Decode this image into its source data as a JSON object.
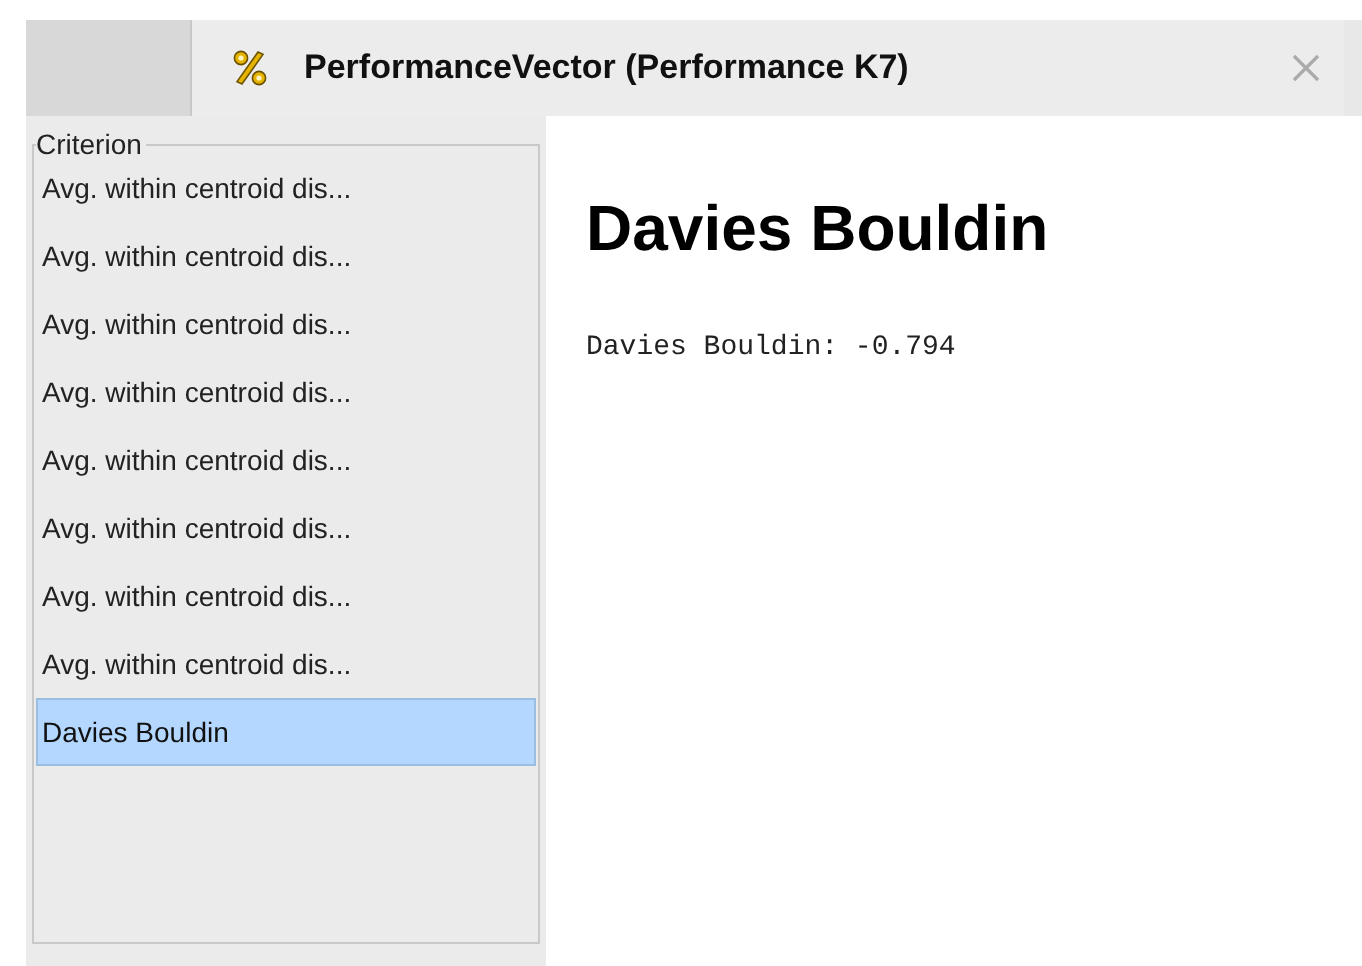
{
  "tab": {
    "title": "PerformanceVector (Performance K7)",
    "selected": true
  },
  "criterion": {
    "legend": "Criterion",
    "items": [
      {
        "label": "Avg. within centroid dis...",
        "selected": false
      },
      {
        "label": "Avg. within centroid dis...",
        "selected": false
      },
      {
        "label": "Avg. within centroid dis...",
        "selected": false
      },
      {
        "label": "Avg. within centroid dis...",
        "selected": false
      },
      {
        "label": "Avg. within centroid dis...",
        "selected": false
      },
      {
        "label": "Avg. within centroid dis...",
        "selected": false
      },
      {
        "label": "Avg. within centroid dis...",
        "selected": false
      },
      {
        "label": "Avg. within centroid dis...",
        "selected": false
      },
      {
        "label": "Davies Bouldin",
        "selected": true
      }
    ]
  },
  "detail": {
    "heading": "Davies Bouldin",
    "value": "Davies Bouldin: -0.794"
  }
}
